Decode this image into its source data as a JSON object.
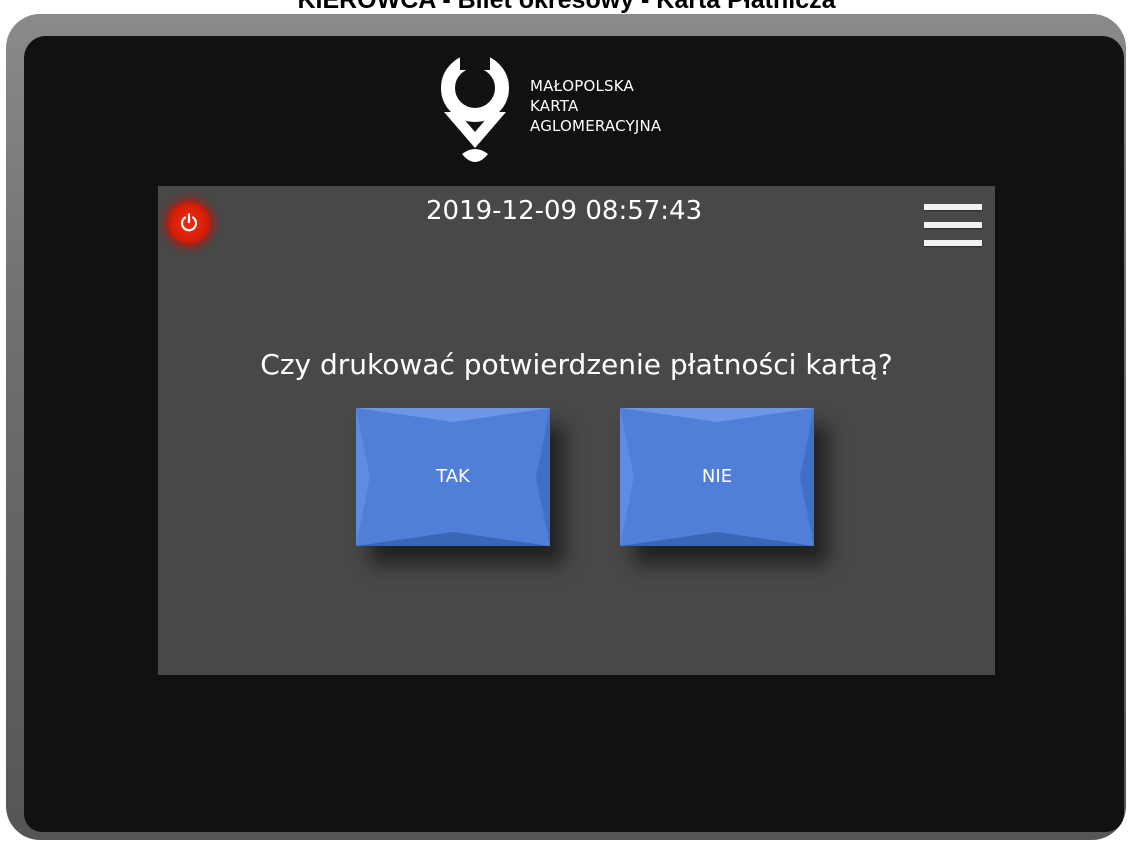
{
  "page": {
    "heading": "KIEROWCA - Bilet okresowy - Karta Płatnicza"
  },
  "logo": {
    "line1": "MAŁOPOLSKA",
    "line2": "KARTA",
    "line3": "AGLOMERACYJNA",
    "icon": "map-pin-logo-icon"
  },
  "header": {
    "datetime": "2019-12-09 08:57:43",
    "power_icon": "power-icon",
    "menu_icon": "hamburger-menu-icon"
  },
  "dialog": {
    "question": "Czy drukować potwierdzenie płatności kartą?",
    "yes_label": "TAK",
    "no_label": "NIE"
  },
  "colors": {
    "screen_bg": "#484848",
    "device_bg": "#111111",
    "button_blue": "#4f7fd6",
    "power_red": "#e02a10"
  }
}
